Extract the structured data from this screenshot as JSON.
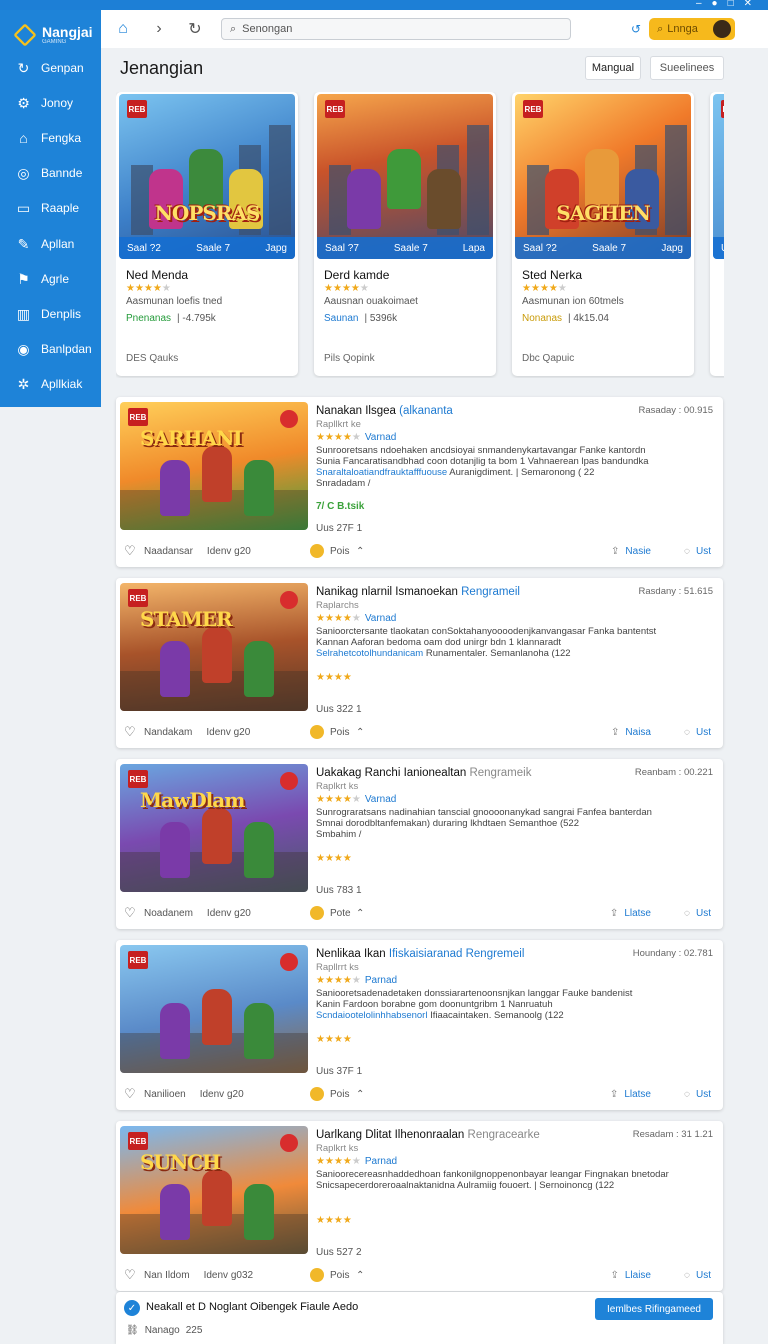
{
  "app": {
    "logo_text": "Nangjai",
    "logo_sub": "GAMING"
  },
  "sidebar": {
    "items": [
      {
        "label": "Genpan",
        "icon": "refresh-icon"
      },
      {
        "label": "Jonoy",
        "icon": "settings-icon"
      },
      {
        "label": "Fengka",
        "icon": "home-icon"
      },
      {
        "label": "Bannde",
        "icon": "compass-icon"
      },
      {
        "label": "Raaple",
        "icon": "window-icon"
      },
      {
        "label": "Apllan",
        "icon": "pencil-icon"
      },
      {
        "label": "Agrle",
        "icon": "bookmark-icon"
      },
      {
        "label": "Denplis",
        "icon": "chart-icon"
      },
      {
        "label": "Banlpdan",
        "icon": "circle-icon"
      },
      {
        "label": "Apllkiak",
        "icon": "gear-icon"
      }
    ]
  },
  "browser": {
    "search_placeholder": "Senongan",
    "user_label": "Lnnga"
  },
  "page": {
    "title": "Jenangian",
    "tab_primary": "Mangual",
    "tab_secondary": "Sueelinees"
  },
  "featured": [
    {
      "badge": "REB",
      "game_title": "NOPSRAS",
      "strip_left": "Saal  ?2",
      "strip_mid": "Saale 7",
      "strip_right": "Japg",
      "name": "Ned Menda",
      "rating": 4,
      "subtitle": "Aasmunan loefis tned",
      "tag": "Pnenanas",
      "meta": "| -4.795k",
      "footer": "DES Qauks"
    },
    {
      "badge": "REB",
      "game_title": "",
      "strip_left": "Saal  ?7",
      "strip_mid": "Saale 7",
      "strip_right": "Lapa",
      "name": "Derd kamde",
      "rating": 4,
      "subtitle": "Aausnan ouakoimaet",
      "tag": "Saunan",
      "meta": "| 5396k",
      "footer": "Pils Qopink"
    },
    {
      "badge": "REB",
      "game_title": "SAGHEN",
      "strip_left": "Saal  ?2",
      "strip_mid": "Saale 7",
      "strip_right": "Japg",
      "name": "Sted Nerka",
      "rating": 4,
      "subtitle": "Aasmunan ion 60tmels",
      "tag": "Nonanas",
      "meta": "| 4k15.04",
      "footer": "Dbc Qapuic"
    },
    {
      "badge": "REB",
      "game_title": "",
      "strip_left": "Ulan",
      "strip_mid": "",
      "strip_right": "",
      "name": "",
      "rating": 0,
      "subtitle": "",
      "tag": "",
      "meta": "",
      "footer": ""
    }
  ],
  "list": [
    {
      "badge": "REB",
      "game_title": "SARHANI",
      "title": "Nanakan Ilsgea",
      "title_accent": "(alkananta",
      "date": "Rasaday : 00.915",
      "subtitle": "Rapllkrt ke",
      "rating": 4,
      "platform": "Varnad",
      "desc1": "Sunrooretsans ndoehaken ancdsioyai snmandenykartavangar Fanke kantordn",
      "desc2": "Sunia Fancaratisandbhad coon dotanjlig ta bom 1 Vahnaerean   lpas bandundka",
      "desc3_link": "Snaraltaloatiandfrauktafffuouse",
      "desc3_rest": "Auranigdiment. | Semaronong ( 22",
      "desc4": "Snradadam /",
      "extra": "7/ C B.tsik",
      "extra_style": "green",
      "num": "Uus  27F  1",
      "fav_label": "Naadansar",
      "size": "Idenv g20",
      "points": "Pois",
      "share": "Nasie",
      "comment": "Ust"
    },
    {
      "badge": "REB",
      "game_title": "STAMER",
      "title": "Nanikag nlarnil Ismanoekan",
      "title_accent": "Rengrameil",
      "date": "Rasdany : 51.615",
      "subtitle": "Raplarchs",
      "rating": 4,
      "platform": "Varnad",
      "desc1": "Sanioorctersante tlaokatan conSoktahanyoooodenjkanvangasar Fanka bantentst",
      "desc2": "Kannan Aaforan bedoma oam dod unirgr bdn 1 klannaradt",
      "desc3_link": "Selrahetcotolhundanicam",
      "desc3_rest": "Runamentaler. Semanlanoha (122",
      "desc4": "",
      "extra": "★★★★",
      "extra_style": "stars",
      "num": "Uus  322  1",
      "fav_label": "Nandakam",
      "size": "Idenv g20",
      "points": "Pois",
      "share": "Naisa",
      "comment": "Ust"
    },
    {
      "badge": "REB",
      "game_title": "MawDlam",
      "title": "Uakakag Ranchi Ianionealtan",
      "title_accent": "",
      "title_grey": "Rengrameik",
      "date": "Reanbam : 00.221",
      "subtitle": "Raplkrt ks",
      "rating": 4,
      "platform": "Varnad",
      "desc1": "Sunrograratsans nadinahian tanscial gnoooonanykad sangrai Fanfea banterdan",
      "desc2": "Smnai dorodbltanfemakan) duraring lkhdtaen Semanthoe (522",
      "desc3_link": "",
      "desc3_rest": "",
      "desc4": "Smbahim /",
      "extra": "★★★★",
      "extra_style": "stars",
      "num": "Uus  783  1",
      "fav_label": "Noadanem",
      "size": "Idenv g20",
      "points": "Pote",
      "share": "Llatse",
      "comment": "Ust"
    },
    {
      "badge": "REB",
      "game_title": "",
      "title": "Nenlikaa Ikan",
      "title_accent": "Ifiskaisiaranad  Rengremeil",
      "date": "Houndany : 02.781",
      "subtitle": "Rapllrrt ks",
      "rating": 4,
      "platform": "Parnad",
      "desc1": "Saniooretsadenadetaken donssiarartenoonsnjkan langgar Fauke bandenist",
      "desc2": "Kanin Fardoon borabne gom doonuntgribm 1 Nanruatuh",
      "desc3_link": "Scndaiootelolinhhabsenorl",
      "desc3_rest": "Ifiaacaintaken. Semanoolg (122",
      "desc4": "",
      "extra": "★★★★",
      "extra_style": "stars",
      "num": "Uus  37F  1",
      "fav_label": "Nanilioen",
      "size": "Idenv g20",
      "points": "Pois",
      "share": "Llatse",
      "comment": "Ust"
    },
    {
      "badge": "REB",
      "game_title": "SUNCH",
      "title": "Uarlkang Dlitat Ilhenonraalan",
      "title_accent": "",
      "title_grey": "Rengracearke",
      "date": "Resadam : 31 1.21",
      "subtitle": "Raplkrt ks",
      "rating": 4,
      "platform": "Parnad",
      "desc1": "Sanioorecereasnhaddedhoan fankonilgnoppenonbayar leangar Fingnakan bnetodar",
      "desc2": "Snicsapecerdoreroaalnaktanidna Aulramiig fouoert. | Sernoinoncg (122",
      "desc3_link": "",
      "desc3_rest": "",
      "desc4": "",
      "extra": "★★★★",
      "extra_style": "stars",
      "num": "Uus  527  2",
      "fav_label": "Nan Ildom",
      "size": "Idenv g032",
      "points": "Pois",
      "share": "Llaise",
      "comment": "Ust"
    }
  ],
  "footer": {
    "title": "Neakall et D Noglant Oibengek Fiaule Aedo",
    "button": "Iemlbes Rifingameed",
    "meta_label": "Nanago",
    "meta_value": "225"
  },
  "colors": {
    "primary": "#1e83d8",
    "accent": "#f6b91c",
    "star": "#f0a91b"
  }
}
